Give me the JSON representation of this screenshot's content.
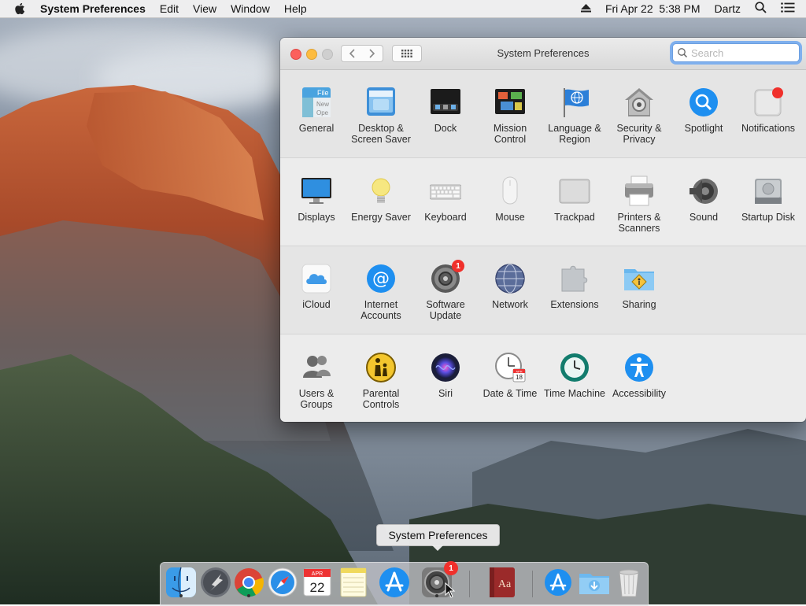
{
  "menubar": {
    "app_name": "System Preferences",
    "menus": [
      "Edit",
      "View",
      "Window",
      "Help"
    ],
    "clock": "Fri Apr 22  5:38 PM",
    "user": "Dartz"
  },
  "window": {
    "title": "System Preferences",
    "search_placeholder": "Search"
  },
  "sections": [
    {
      "items": [
        {
          "label": "General",
          "icon": "general-icon"
        },
        {
          "label": "Desktop & Screen Saver",
          "icon": "desktop-icon"
        },
        {
          "label": "Dock",
          "icon": "dock-icon"
        },
        {
          "label": "Mission Control",
          "icon": "mission-control-icon"
        },
        {
          "label": "Language & Region",
          "icon": "language-flag-icon"
        },
        {
          "label": "Security & Privacy",
          "icon": "security-house-icon"
        },
        {
          "label": "Spotlight",
          "icon": "spotlight-icon"
        },
        {
          "label": "Notifications",
          "icon": "notifications-icon"
        }
      ]
    },
    {
      "items": [
        {
          "label": "Displays",
          "icon": "display-icon"
        },
        {
          "label": "Energy Saver",
          "icon": "lightbulb-icon"
        },
        {
          "label": "Keyboard",
          "icon": "keyboard-icon"
        },
        {
          "label": "Mouse",
          "icon": "mouse-icon"
        },
        {
          "label": "Trackpad",
          "icon": "trackpad-icon"
        },
        {
          "label": "Printers & Scanners",
          "icon": "printer-icon"
        },
        {
          "label": "Sound",
          "icon": "speaker-icon"
        },
        {
          "label": "Startup Disk",
          "icon": "disk-icon"
        }
      ]
    },
    {
      "items": [
        {
          "label": "iCloud",
          "icon": "icloud-icon"
        },
        {
          "label": "Internet Accounts",
          "icon": "at-sign-icon"
        },
        {
          "label": "Software Update",
          "icon": "gear-icon",
          "badge": "1"
        },
        {
          "label": "Network",
          "icon": "globe-icon"
        },
        {
          "label": "Extensions",
          "icon": "puzzle-icon"
        },
        {
          "label": "Sharing",
          "icon": "sharing-folder-icon"
        }
      ]
    },
    {
      "items": [
        {
          "label": "Users & Groups",
          "icon": "users-icon"
        },
        {
          "label": "Parental Controls",
          "icon": "parental-icon"
        },
        {
          "label": "Siri",
          "icon": "siri-icon"
        },
        {
          "label": "Date & Time",
          "icon": "clock-calendar-icon"
        },
        {
          "label": "Time Machine",
          "icon": "time-machine-icon"
        },
        {
          "label": "Accessibility",
          "icon": "accessibility-icon"
        }
      ]
    }
  ],
  "general_icon_text": [
    "File",
    "New",
    "Ope"
  ],
  "date_time_icon_text": {
    "month": "APR",
    "day": "18"
  },
  "dock": {
    "tooltip": "System Preferences",
    "calendar_month": "APR",
    "calendar_day": "22",
    "dictionary_label": "Aa",
    "update_badge": "1",
    "items": [
      "finder-icon",
      "launchpad-icon",
      "chrome-icon",
      "safari-icon",
      "calendar-icon",
      "notes-icon",
      "app-store-icon",
      "system-preferences-icon",
      "dictionary-icon",
      "app-store-downloads-icon",
      "downloads-folder-icon",
      "trash-icon"
    ]
  },
  "colors": {
    "badge": "#f0302b",
    "focus": "#7fb0ee",
    "accent": "#1e8ff0"
  }
}
